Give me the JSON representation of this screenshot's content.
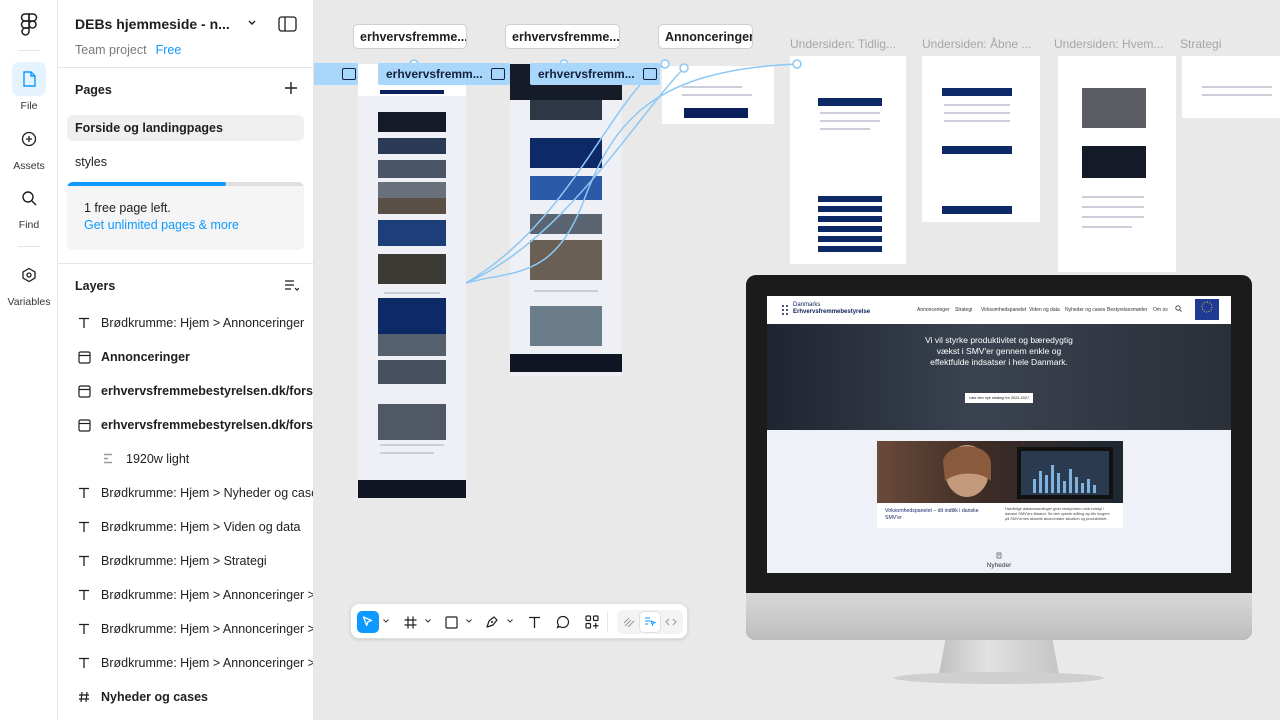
{
  "rail": {
    "items": [
      {
        "label": "File"
      },
      {
        "label": "Assets"
      },
      {
        "label": "Find"
      },
      {
        "label": "Variables"
      }
    ]
  },
  "panel": {
    "file_title": "DEBs hjemmeside - n...",
    "project_label": "Team project",
    "plan_badge": "Free",
    "pages_title": "Pages",
    "pages": [
      {
        "label": "Forside og landingpages",
        "selected": true
      },
      {
        "label": "styles",
        "selected": false
      }
    ],
    "upsell": {
      "text": "1 free page left.",
      "link": "Get unlimited pages & more",
      "progress": 0.67
    },
    "layers_title": "Layers",
    "layers": [
      {
        "type": "text",
        "label": "Brødkrumme: Hjem > Annonceringer",
        "bold": false
      },
      {
        "type": "frame",
        "label": "Annonceringer",
        "bold": true
      },
      {
        "type": "frame",
        "label": "erhvervsfremmebestyrelsen.dk/forside",
        "bold": true
      },
      {
        "type": "frame",
        "label": "erhvervsfremmebestyrelsen.dk/forside",
        "bold": true
      },
      {
        "type": "component",
        "label": "1920w light",
        "bold": false
      },
      {
        "type": "text",
        "label": "Brødkrumme: Hjem > Nyheder og cases",
        "bold": false
      },
      {
        "type": "text",
        "label": "Brødkrumme: Hjem > Viden og data",
        "bold": false
      },
      {
        "type": "text",
        "label": "Brødkrumme: Hjem > Strategi",
        "bold": false
      },
      {
        "type": "text",
        "label": "Brødkrumme: Hjem > Annonceringer >",
        "bold": false
      },
      {
        "type": "text",
        "label": "Brødkrumme: Hjem > Annonceringer >",
        "bold": false
      },
      {
        "type": "text",
        "label": "Brødkrumme: Hjem > Annonceringer >",
        "bold": false
      },
      {
        "type": "hash",
        "label": "Nyheder og cases",
        "bold": true
      }
    ]
  },
  "canvas": {
    "tags": [
      "erhvervsfremme...",
      "erhvervsfremme...",
      "Annonceringer"
    ],
    "frame_names": [
      "Undersiden: Tidlig...",
      "Undersiden: Åbne ...",
      "Undersiden: Hvem...",
      "Strategi"
    ],
    "blue_labels": [
      "erhvervsfremm...",
      "erhvervsfremm..."
    ],
    "site": {
      "logo_line1": "Danmarks",
      "logo_line2": "Erhvervsfremmebestyrelse",
      "nav": [
        "Annonceringer",
        "Strategi",
        "Virksomhedspanelet",
        "Viden og data",
        "Nyheder og cases",
        "Bestyrelsesmøder",
        "Om os"
      ],
      "hero_text": "Vi vil styrke produktivitet og bæredygtig vækst i SMV'er gennem enkle og effektfulde indsatser i hele Danmark.",
      "hero_button": "Læs den nye strategi for 2024-2027",
      "card_title": "Virksomhedspanelet – dit indtlik i danske SMV'er",
      "card_body": "Halvårlige dataindsamlinger giver bestyrelsen unik indsigt i danske SMV'ers tilstand. Se den nyeste måling og bliv klogere på SMV'ernes aktuelle økonomiske situation og produktivitet.",
      "news_label": "Nyheder"
    }
  },
  "toolbar": {
    "tools": [
      "move-tool",
      "frame-tool",
      "shape-tool",
      "pen-tool",
      "text-tool",
      "comment-tool",
      "actions-tool"
    ],
    "modes": [
      "draw-mode",
      "design-mode",
      "dev-mode"
    ],
    "accent": "#0d99ff"
  }
}
